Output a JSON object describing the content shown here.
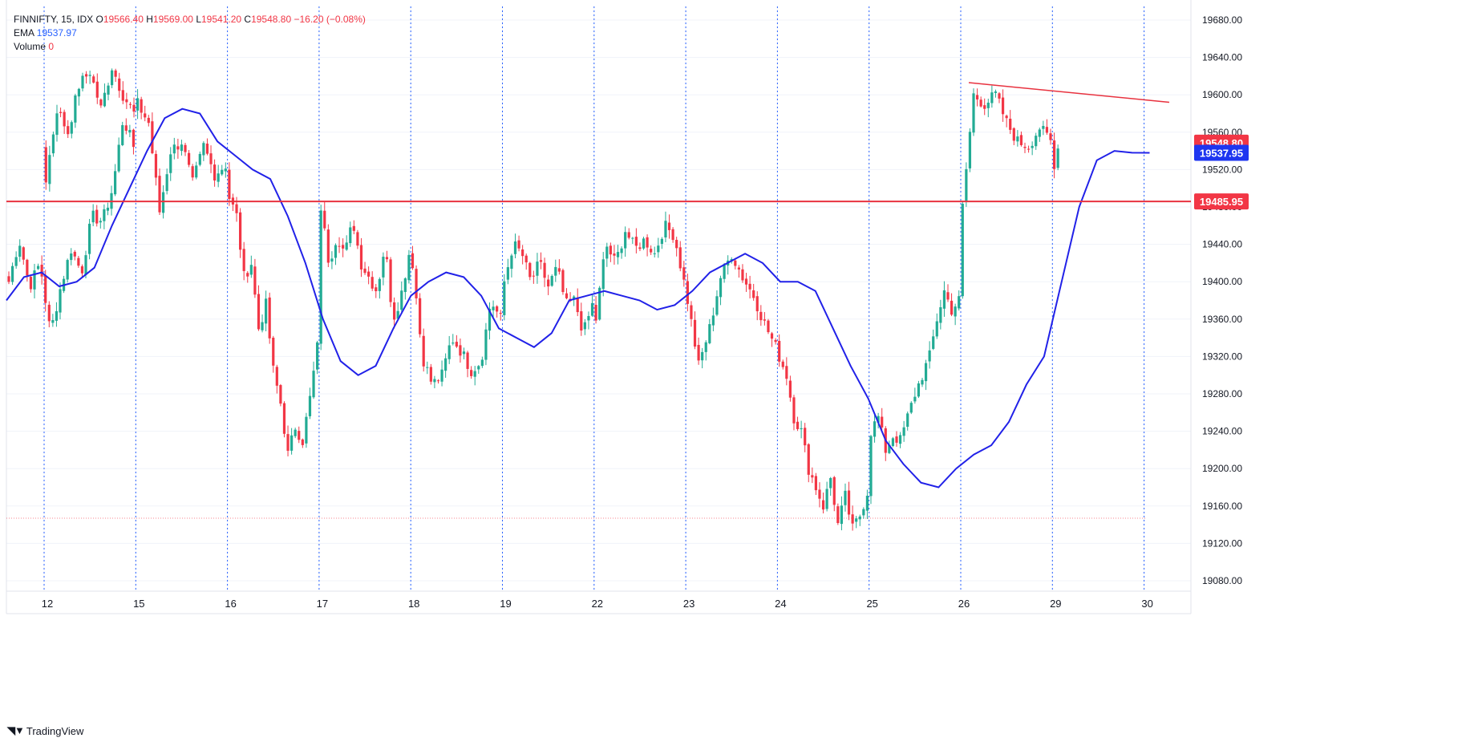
{
  "legend": {
    "symbol": "FINNIFTY, 15, IDX",
    "o_label": "O",
    "o_value": "19566.40",
    "h_label": "H",
    "h_value": "19569.00",
    "l_label": "L",
    "l_value": "19541.20",
    "c_label": "C",
    "c_value": "19548.80",
    "change": "−16.20 (−0.08%)",
    "ema_label": "EMA",
    "ema_value": "19537.97",
    "volume_label": "Volume",
    "volume_value": "0"
  },
  "brand": {
    "name": "TradingView"
  },
  "colors": {
    "up": "#22ab94",
    "down": "#f23645",
    "ema": "#2121e8",
    "hline": "#e8323f",
    "trendline": "#e8323f",
    "grid": "#f0f3fa",
    "session": "#2962ff",
    "axis_text": "#131722"
  },
  "chart_data": {
    "type": "candlestick",
    "instrument": "FINNIFTY",
    "interval": "15",
    "ylim": [
      19060,
      19700
    ],
    "y_ticks": [
      19080,
      19120,
      19160,
      19200,
      19240,
      19280,
      19320,
      19360,
      19400,
      19440,
      19480,
      19520,
      19560,
      19600,
      19640,
      19680
    ],
    "x_labels": [
      "12",
      "15",
      "16",
      "17",
      "18",
      "19",
      "22",
      "23",
      "24",
      "25",
      "26",
      "29",
      "30"
    ],
    "bars_per_session": 25,
    "session_paths": [
      [
        19400,
        19445,
        19395,
        19420,
        19345,
        19395,
        19435,
        19410,
        19470,
        19465,
        19500,
        19575,
        19545
      ],
      [
        19510,
        19585,
        19560,
        19610,
        19625,
        19585,
        19630,
        19600,
        19580
      ],
      [
        19590,
        19570,
        19475,
        19540,
        19550,
        19505,
        19545,
        19515,
        19525
      ],
      [
        19490,
        19470,
        19405,
        19420,
        19350,
        19375,
        19305,
        19270,
        19215,
        19245,
        19230,
        19275,
        19330
      ],
      [
        19480,
        19420,
        19450,
        19430,
        19465,
        19420,
        19405,
        19390,
        19440,
        19360,
        19385,
        19430
      ],
      [
        19420,
        19320,
        19290,
        19300,
        19340,
        19325,
        19305,
        19315,
        19380,
        19360
      ],
      [
        19400,
        19440,
        19430,
        19400,
        19420,
        19395,
        19415,
        19375,
        19380,
        19345,
        19375
      ],
      [
        19360,
        19440,
        19420,
        19455,
        19435,
        19445,
        19430,
        19460,
        19450,
        19400
      ],
      [
        19380,
        19310,
        19350,
        19405,
        19430,
        19405,
        19385,
        19355,
        19330
      ],
      [
        19320,
        19300,
        19255,
        19240,
        19200,
        19180,
        19160,
        19190,
        19140,
        19170,
        19135,
        19150,
        19175
      ],
      [
        19240,
        19255,
        19220,
        19235,
        19230,
        19255,
        19280,
        19300,
        19320,
        19360,
        19390,
        19370,
        19380
      ],
      [
        19480,
        19600,
        19590,
        19600,
        19570,
        19550,
        19545,
        19565,
        19550
      ],
      [
        19520,
        19548.8
      ]
    ],
    "ema_path": [
      [
        19380,
        19405,
        19410,
        19395,
        19400,
        19415,
        19460,
        19500,
        19540,
        19575,
        19585,
        19580
      ],
      [
        19550,
        19535,
        19520,
        19510,
        19470,
        19420,
        19360,
        19315,
        19300
      ],
      [
        19310,
        19350,
        19385,
        19400,
        19410,
        19405,
        19385,
        19350,
        19340,
        19330,
        19345
      ],
      [
        19380,
        19385,
        19390,
        19385,
        19380,
        19370,
        19375,
        19390,
        19410,
        19420,
        19430
      ],
      [
        19420,
        19400,
        19400,
        19390,
        19350,
        19310,
        19275,
        19230,
        19205,
        19185,
        19180
      ],
      [
        19200,
        19215,
        19225,
        19250,
        19290,
        19320,
        19400,
        19480,
        19530,
        19540,
        19538,
        19537.95
      ]
    ],
    "horizontal_line": 19485.95,
    "trendline": {
      "from": {
        "session": 11,
        "bar": 0,
        "y": 19613
      },
      "to": {
        "session": 12,
        "bar": 8,
        "y": 19592
      }
    },
    "price_labels": [
      {
        "value": "19548.80",
        "kind": "last_price"
      },
      {
        "value": "19537.95",
        "kind": "ema"
      },
      {
        "value": "19485.95",
        "kind": "horizontal_line"
      }
    ],
    "dotted_low_line": 19147,
    "grid": true
  }
}
